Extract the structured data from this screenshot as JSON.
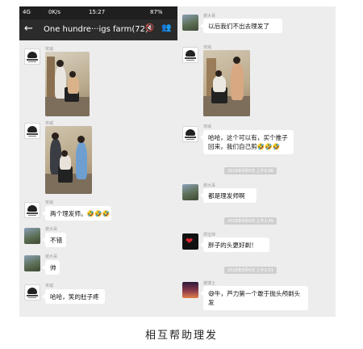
{
  "left": {
    "status": {
      "carrier": "4G",
      "speed": "0K/s",
      "time": "15:27",
      "battery": "87%"
    },
    "header": {
      "title": "One hundre···igs farm(72)"
    },
    "messages": [
      {
        "sender": "宋威"
      },
      {
        "sender": "宋威"
      },
      {
        "sender": "宋威",
        "text": "两个理发师。🤣🤣🤣"
      },
      {
        "sender": "谢大哥",
        "text": "不错"
      },
      {
        "sender": "谢大哥",
        "text": "帅"
      },
      {
        "sender": "宋威",
        "text": "哈哈，笑的肚子疼"
      }
    ]
  },
  "right": {
    "messages": [
      {
        "sender": "谢大哥",
        "text": "以后我们不出去理发了"
      },
      {
        "sender": "宋威"
      },
      {
        "sender": "宋威",
        "text": "哈哈，这个可以有，买个推子回来，我们自己剪🤣🤣🤣"
      },
      {
        "sender": "谢大哥",
        "text": "都是理发师啊"
      },
      {
        "sender": "周宝璋",
        "text": "胖子的头更好剃！"
      },
      {
        "sender": "谢博士",
        "text": "😅牛，芦力第一个敢于抛头颅剃头发"
      }
    ],
    "timestamps": [
      "2018年8月6日 上午0:06",
      "2018年8月6日 上午1:45",
      "2018年8月6日 上午2:51"
    ]
  },
  "caption": "相互帮助理发",
  "colors": {
    "statusbar": "#1f1f1f",
    "titlebar": "#2b2b2b",
    "chat_bg": "#ededed",
    "bubble": "#ffffff"
  },
  "icons": [
    "back-arrow-icon",
    "mute-icon",
    "members-icon"
  ]
}
